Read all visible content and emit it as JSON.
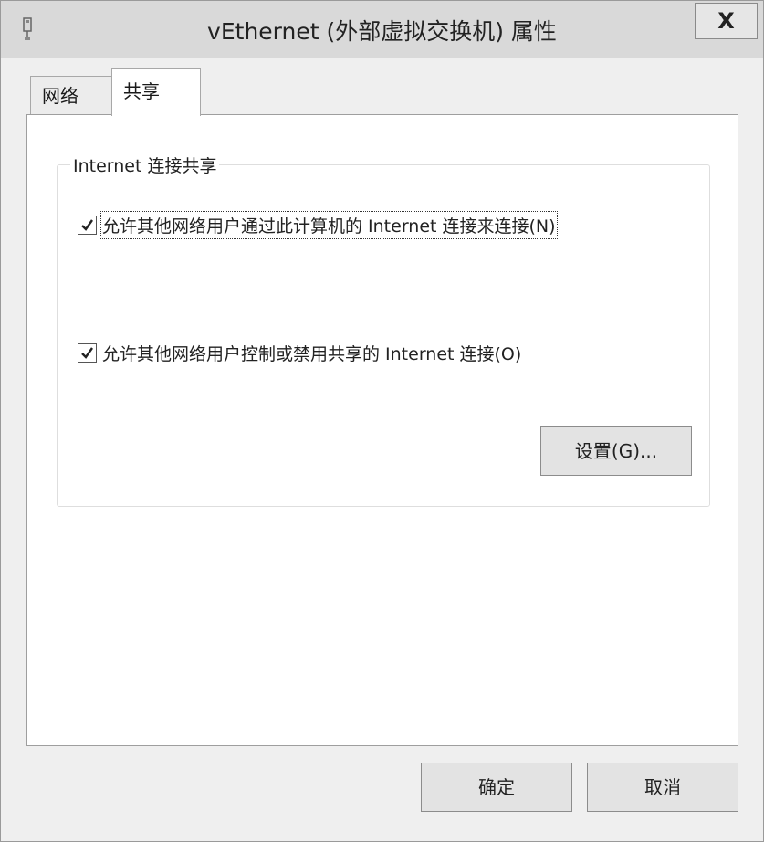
{
  "window": {
    "title": "vEthernet (外部虚拟交换机) 属性",
    "close_label": "X"
  },
  "tabs": [
    {
      "label": "网络",
      "selected": false
    },
    {
      "label": "共享",
      "selected": true
    }
  ],
  "sharing": {
    "group_title": "Internet 连接共享",
    "allow_connect": {
      "label": "允许其他网络用户通过此计算机的 Internet 连接来连接(N)",
      "checked": true
    },
    "allow_control": {
      "label": "允许其他网络用户控制或禁用共享的 Internet 连接(O)",
      "checked": true
    },
    "settings_label": "设置(G)..."
  },
  "footer": {
    "ok_label": "确定",
    "cancel_label": "取消"
  },
  "colors": {
    "window_bg": "#d6d6d6",
    "panel_bg": "#ffffff",
    "button_bg": "#e3e3e3"
  }
}
